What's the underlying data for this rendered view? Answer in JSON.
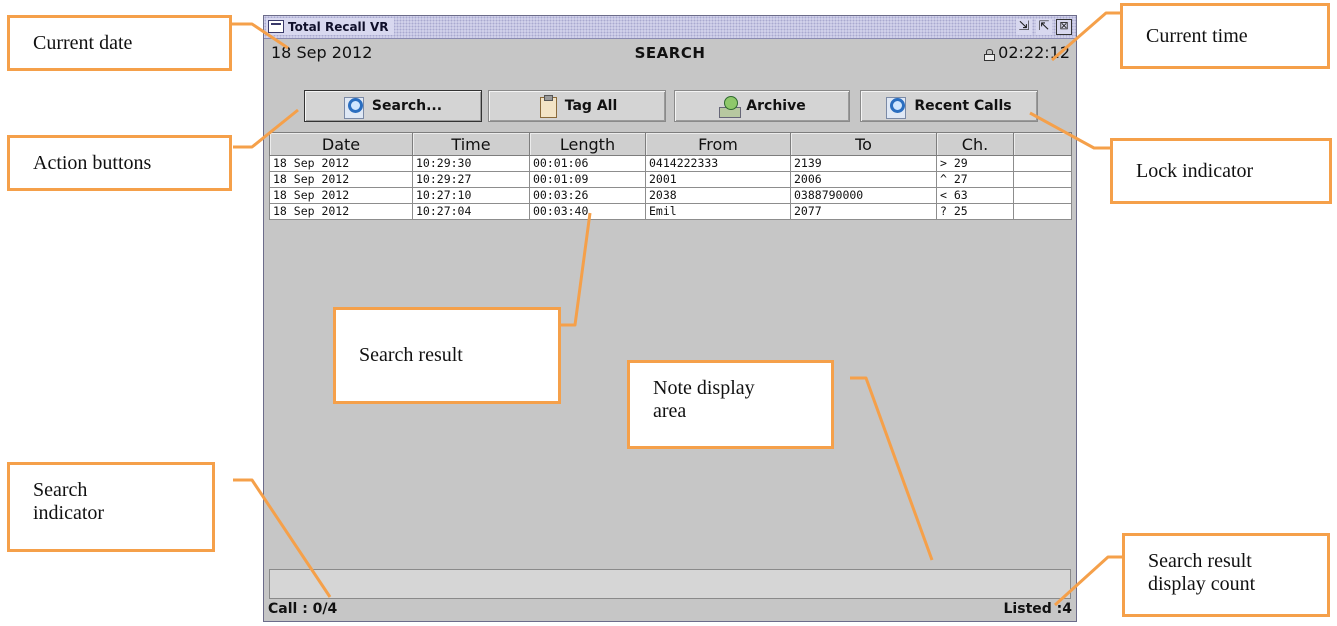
{
  "window": {
    "title": "Total Recall VR",
    "controls": {
      "minimize_icon": "minimize-icon",
      "maximize_icon": "maximize-icon",
      "close_icon": "close-icon"
    }
  },
  "header": {
    "date": "18 Sep 2012",
    "screen_title": "SEARCH",
    "time": "02:22:12",
    "lock_icon": "lock-icon"
  },
  "toolbar": {
    "buttons": [
      {
        "label": "Search...",
        "icon": "search-icon",
        "active": true
      },
      {
        "label": "Tag All",
        "icon": "clipboard-icon"
      },
      {
        "label": "Archive",
        "icon": "archive-disc-icon"
      },
      {
        "label": "Recent Calls",
        "icon": "search-icon"
      }
    ]
  },
  "table": {
    "columns": [
      "Date",
      "Time",
      "Length",
      "From",
      "To",
      "Ch.",
      ""
    ],
    "rows": [
      [
        "18 Sep 2012",
        "10:29:30",
        "00:01:06",
        "0414222333",
        "2139",
        "> 29",
        ""
      ],
      [
        "18 Sep 2012",
        "10:29:27",
        "00:01:09",
        "2001",
        "2006",
        "^ 27",
        ""
      ],
      [
        "18 Sep 2012",
        "10:27:10",
        "00:03:26",
        "2038",
        "0388790000",
        "< 63",
        ""
      ],
      [
        "18 Sep 2012",
        "10:27:04",
        "00:03:40",
        "Emil",
        "2077",
        "? 25",
        ""
      ]
    ]
  },
  "status": {
    "call": "Call : 0/4",
    "listed": "Listed :4"
  },
  "callouts": {
    "current_date": "Current date",
    "action_buttons": "Action buttons",
    "search_indicator": "Search indicator",
    "search_result": "Search result",
    "note_display_area": "Note display area",
    "current_time": "Current time",
    "lock_indicator": "Lock indicator",
    "search_result_display_count": "Search result display count"
  },
  "colors": {
    "callout_border": "#f5a04a",
    "window_bg": "#c6c6c6",
    "titlebar": "#d8d8ef"
  }
}
